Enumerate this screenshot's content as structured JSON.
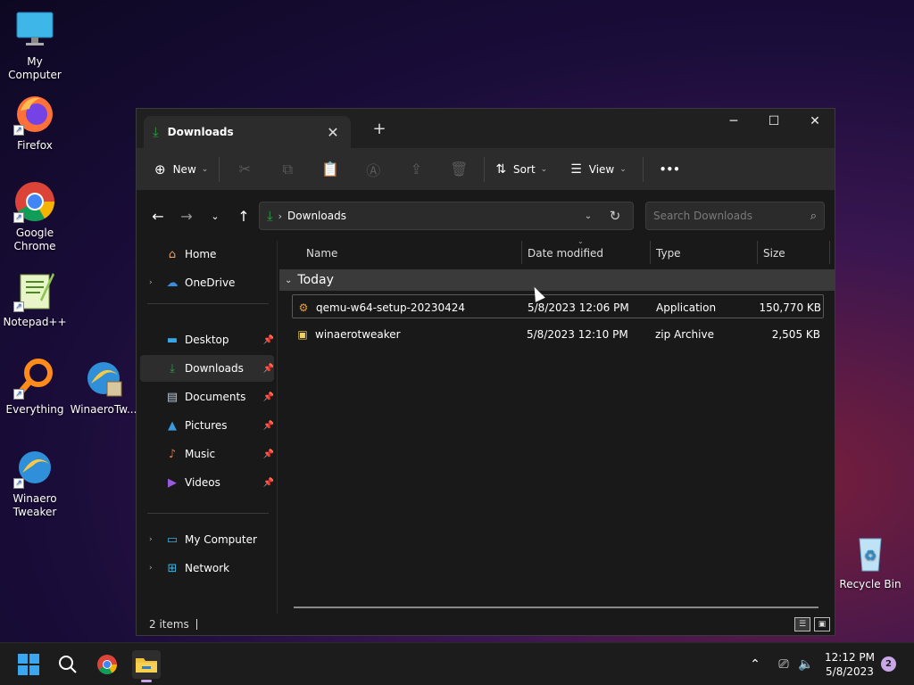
{
  "desktop": {
    "icons": [
      {
        "label": "My Computer",
        "icon": "monitor-icon"
      },
      {
        "label": "Firefox",
        "icon": "firefox-icon"
      },
      {
        "label": "Google Chrome",
        "icon": "chrome-icon"
      },
      {
        "label": "Notepad++",
        "icon": "notepadpp-icon"
      },
      {
        "label": "Everything",
        "icon": "everything-icon"
      },
      {
        "label": "WinaeroTw...",
        "icon": "winaero-tweaker-icon"
      },
      {
        "label": "Winaero Tweaker",
        "icon": "winaero-tweaker-icon"
      },
      {
        "label": "Recycle Bin",
        "icon": "recycle-bin-icon"
      }
    ]
  },
  "window": {
    "tab_title": "Downloads",
    "toolbar": {
      "new_label": "New",
      "sort_label": "Sort",
      "view_label": "View",
      "more_label": "•••"
    },
    "address": {
      "crumb": "Downloads",
      "search_placeholder": "Search Downloads"
    },
    "nav": {
      "items": [
        {
          "label": "Home"
        },
        {
          "label": "OneDrive"
        },
        {
          "label": "Desktop"
        },
        {
          "label": "Downloads"
        },
        {
          "label": "Documents"
        },
        {
          "label": "Pictures"
        },
        {
          "label": "Music"
        },
        {
          "label": "Videos"
        },
        {
          "label": "My Computer"
        },
        {
          "label": "Network"
        }
      ]
    },
    "columns": [
      "Name",
      "Date modified",
      "Type",
      "Size"
    ],
    "group_label": "Today",
    "files": [
      {
        "name": "qemu-w64-setup-20230424",
        "date": "5/8/2023 12:06 PM",
        "type": "Application",
        "size": "150,770 KB"
      },
      {
        "name": "winaerotweaker",
        "date": "5/8/2023 12:10 PM",
        "type": "zip Archive",
        "size": "2,505 KB"
      }
    ],
    "status": "2 items"
  },
  "taskbar": {
    "time": "12:12 PM",
    "date": "5/8/2023",
    "notifications": "2"
  },
  "colors": {
    "accent": "#2ea043",
    "win_blue": "#1e90ff"
  }
}
